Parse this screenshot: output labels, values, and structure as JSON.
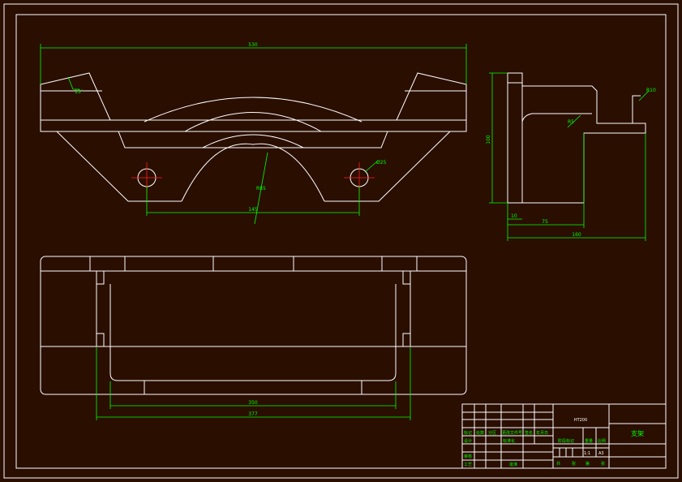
{
  "drawing": {
    "dimensions": {
      "top_overall": "530",
      "angle": "15°",
      "radius_main": "R85",
      "hole_pitch": "145",
      "hole_dia": "Ø25",
      "side_height": "100",
      "side_step": "10",
      "side_inner": "75",
      "side_overall": "160",
      "side_radius": "R5",
      "side_radius_small": "R10",
      "bottom_inner": "350",
      "bottom_outer": "377"
    },
    "title_block": {
      "part_name": "支架",
      "material": "HT200",
      "scale": "1:1",
      "mark": "A3",
      "labels": {
        "designer": "设计",
        "standard": "标准化",
        "checker": "审核",
        "process": "工艺",
        "approve": "批准",
        "mark_col": "标记",
        "count_col": "处数",
        "zone_col": "分区",
        "doc_col": "更改文件号",
        "sign_col": "签名",
        "date_col": "年月日",
        "stage": "阶段标记",
        "weight": "重量",
        "ratio": "比例",
        "sheet_total": "共",
        "sheet_unit": "张",
        "sheet_no": "第"
      }
    }
  }
}
